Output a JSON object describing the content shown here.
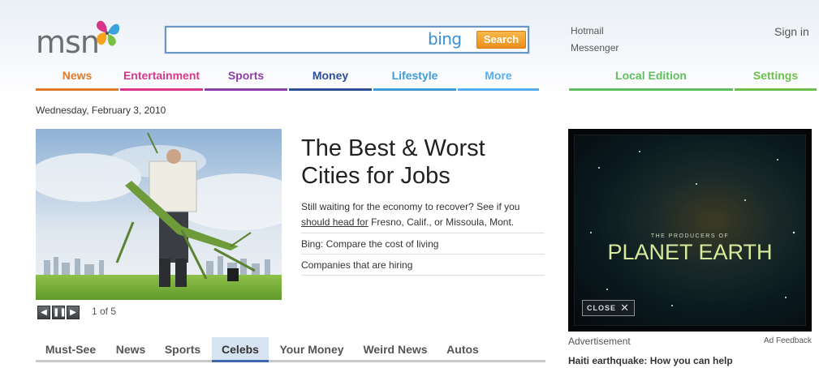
{
  "logo": {
    "text": "msn"
  },
  "search": {
    "value": "",
    "placeholder": "",
    "engine_logo": "bing",
    "button_label": "Search"
  },
  "top_links": {
    "hotmail": "Hotmail",
    "messenger": "Messenger",
    "sign_in": "Sign in"
  },
  "nav": {
    "items": [
      {
        "label": "News",
        "color": "#e07b2a"
      },
      {
        "label": "Entertainment",
        "color": "#d8378a"
      },
      {
        "label": "Sports",
        "color": "#8c3fa9"
      },
      {
        "label": "Money",
        "color": "#2e4f97"
      },
      {
        "label": "Lifestyle",
        "color": "#3d9bd9"
      },
      {
        "label": "More",
        "color": "#56aef0"
      }
    ],
    "right_items": [
      {
        "label": "Local Edition",
        "color": "#5fbf5f"
      },
      {
        "label": "Settings",
        "color": "#6bc04b"
      }
    ]
  },
  "date": "Wednesday, February 3, 2010",
  "feature": {
    "headline": "The Best & Worst Cities for Jobs",
    "blurb_prefix": "Still waiting for the economy to recover? See if you ",
    "blurb_link": "should head for",
    "blurb_suffix": " Fresno, Calif., or Missoula, Mont.",
    "related": [
      "Bing: Compare the cost of living",
      "Companies that are hiring"
    ],
    "counter": "1 of 5",
    "image_icon": "man-with-map-and-mantis-image"
  },
  "carousel_controls": {
    "prev_icon": "chevron-left-icon",
    "pause_icon": "pause-icon",
    "next_icon": "chevron-right-icon"
  },
  "tabs": {
    "items": [
      "Must-See",
      "News",
      "Sports",
      "Celebs",
      "Your Money",
      "Weird News",
      "Autos"
    ],
    "active": "Celebs"
  },
  "ad": {
    "producers": "THE PRODUCERS OF",
    "title": "PLANET EARTH",
    "close_label": "CLOSE",
    "label": "Advertisement",
    "feedback": "Ad Feedback"
  },
  "news_link": "Haiti earthquake: How you can help"
}
